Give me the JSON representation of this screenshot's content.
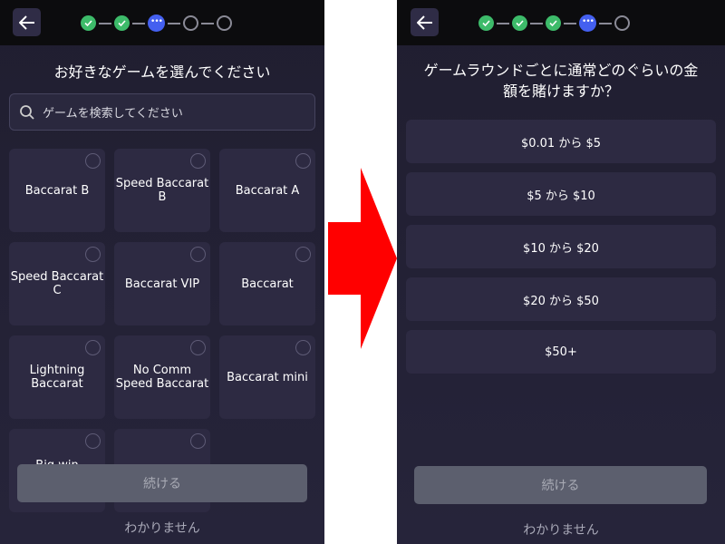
{
  "left": {
    "title": "お好きなゲームを選んでください",
    "search_placeholder": "ゲームを検索してください",
    "games": [
      "Baccarat B",
      "Speed Baccarat B",
      "Baccarat A",
      "Speed Baccarat C",
      "Baccarat VIP",
      "Baccarat",
      "Lightning Baccarat",
      "No Comm Speed Baccarat",
      "Baccarat mini",
      "Big win",
      ""
    ],
    "continue_label": "続ける",
    "dont_know_label": "わかりません",
    "steps": [
      "done",
      "done",
      "current",
      "todo",
      "todo"
    ]
  },
  "right": {
    "title_line1": "ゲームラウンドごとに通常どのぐらいの金",
    "title_line2": "額を賭けますか？",
    "options": [
      "$0.01 から $5",
      "$5 から $10",
      "$10 から $20",
      "$20 から $50",
      "$50+"
    ],
    "continue_label": "続ける",
    "dont_know_label": "わかりません",
    "steps": [
      "done",
      "done",
      "done",
      "current",
      "todo"
    ]
  },
  "colors": {
    "arrow": "#ff0000",
    "done": "#3dbb6a",
    "current": "#4460f0"
  }
}
